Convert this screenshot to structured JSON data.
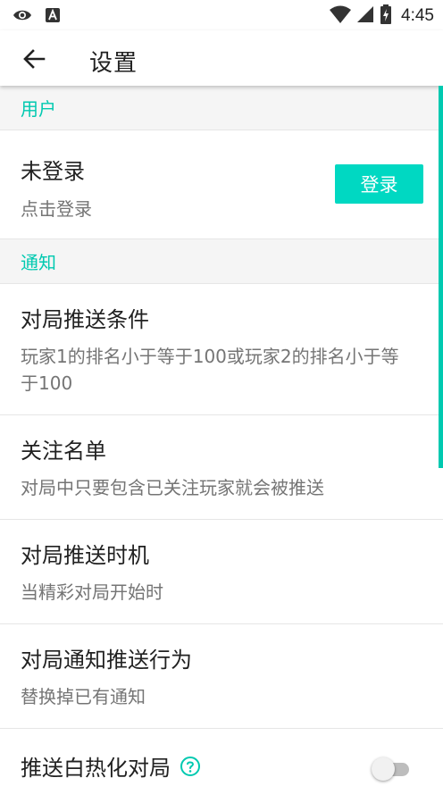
{
  "status_bar": {
    "time": "4:45",
    "icons": [
      "eye-icon",
      "accessibility-a-icon",
      "wifi-icon",
      "cell-signal-icon",
      "battery-charging-icon"
    ]
  },
  "toolbar": {
    "back_icon": "arrow-left-icon",
    "title": "设置"
  },
  "sections": {
    "user": {
      "header": "用户",
      "login_title": "未登录",
      "login_subtitle": "点击登录",
      "login_button": "登录"
    },
    "notify": {
      "header": "通知",
      "items": [
        {
          "title": "对局推送条件",
          "subtitle": "玩家1的排名小于等于100或玩家2的排名小于等于100"
        },
        {
          "title": "关注名单",
          "subtitle": "对局中只要包含已关注玩家就会被推送"
        },
        {
          "title": "对局推送时机",
          "subtitle": "当精彩对局开始时"
        },
        {
          "title": "对局通知推送行为",
          "subtitle": "替换掉已有通知"
        }
      ],
      "switch_item": {
        "title": "推送白热化对局",
        "help_icon": "question-circle-icon",
        "enabled": false
      }
    }
  },
  "colors": {
    "accent": "#00c9b0",
    "button": "#00d8c2",
    "section_bg": "#f5f5f5",
    "text_primary": "#212121",
    "text_secondary": "#757575"
  }
}
